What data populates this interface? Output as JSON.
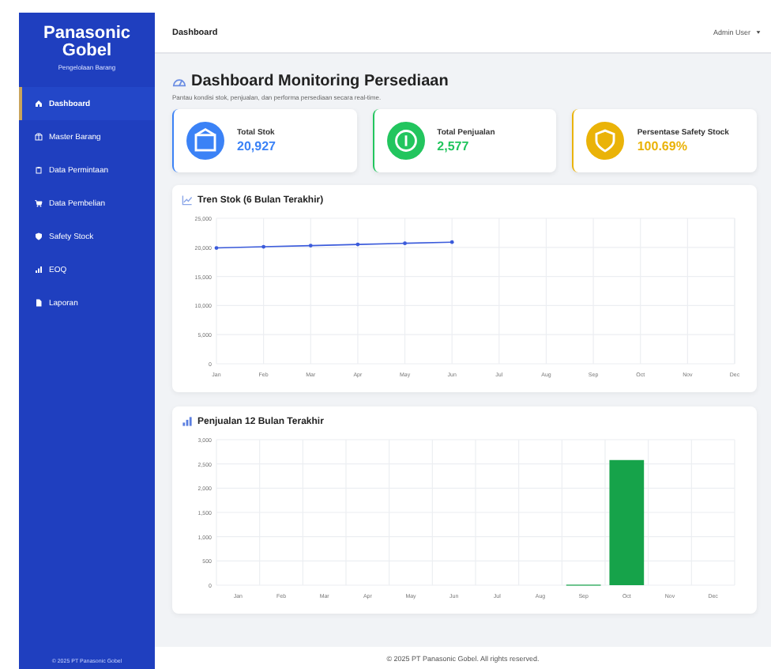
{
  "sidebar": {
    "brand": "Panasonic Gobel",
    "tagline": "Pengelolaan Barang",
    "items": [
      {
        "label": "Dashboard",
        "selected": true
      },
      {
        "label": "Master Barang",
        "selected": false
      },
      {
        "label": "Data Permintaan",
        "selected": false
      },
      {
        "label": "Data Pembelian",
        "selected": false
      },
      {
        "label": "Safety Stock",
        "selected": false
      },
      {
        "label": "EOQ",
        "selected": false
      },
      {
        "label": "Laporan",
        "selected": false
      }
    ],
    "footer": "© 2025 PT Panasonic Gobel"
  },
  "topbar": {
    "title": "Dashboard",
    "user": "Admin User"
  },
  "heading": "Dashboard Monitoring Persediaan",
  "description": "Pantau kondisi stok, penjualan, dan performa persediaan secara real-time.",
  "cards": [
    {
      "label": "Total Stok",
      "value": "20,927",
      "color": "#3b82f6"
    },
    {
      "label": "Total Penjualan",
      "value": "2,577",
      "color": "#22c55e"
    },
    {
      "label": "Persentase Safety Stock",
      "value": "100.69%",
      "color": "#eab308"
    }
  ],
  "charts": [
    {
      "chart_data": {
        "type": "line",
        "title": "Tren Stok (6 Bulan Terakhir)",
        "categories": [
          "Jan",
          "Feb",
          "Mar",
          "Apr",
          "May",
          "Jun",
          "Jul",
          "Aug",
          "Sep",
          "Oct",
          "Nov",
          "Dec"
        ],
        "grid": true,
        "series": [
          {
            "color": "#3b5bdb",
            "values": [
              19900,
              20100,
              20300,
              20500,
              20700,
              20900,
              null,
              null,
              null,
              null,
              null,
              null
            ]
          }
        ],
        "ylim": [
          0,
          25000
        ],
        "yticks": [
          {
            "value": 0,
            "label": "0"
          },
          {
            "value": 5000,
            "label": "5,000"
          },
          {
            "value": 10000,
            "label": "10,000"
          },
          {
            "value": 15000,
            "label": "15,000"
          },
          {
            "value": 20000,
            "label": "20,000"
          },
          {
            "value": 25000,
            "label": "25,000"
          }
        ]
      }
    },
    {
      "chart_data": {
        "type": "bar",
        "title": "Penjualan 12 Bulan Terakhir",
        "categories": [
          "Jan",
          "Feb",
          "Mar",
          "Apr",
          "May",
          "Jun",
          "Jul",
          "Aug",
          "Sep",
          "Oct",
          "Nov",
          "Dec"
        ],
        "grid": true,
        "series": [
          {
            "color": "#16a34a",
            "values": [
              0,
              0,
              0,
              0,
              0,
              0,
              0,
              0,
              10,
              2580,
              0,
              0
            ]
          }
        ],
        "ylim": [
          0,
          3000
        ],
        "yticks": [
          {
            "value": 0,
            "label": "0"
          },
          {
            "value": 500,
            "label": "500"
          },
          {
            "value": 1000,
            "label": "1,000"
          },
          {
            "value": 1500,
            "label": "1,500"
          },
          {
            "value": 2000,
            "label": "2,000"
          },
          {
            "value": 2500,
            "label": "2,500"
          },
          {
            "value": 3000,
            "label": "3,000"
          }
        ]
      }
    }
  ],
  "footer": "© 2025 PT Panasonic Gobel. All rights reserved."
}
